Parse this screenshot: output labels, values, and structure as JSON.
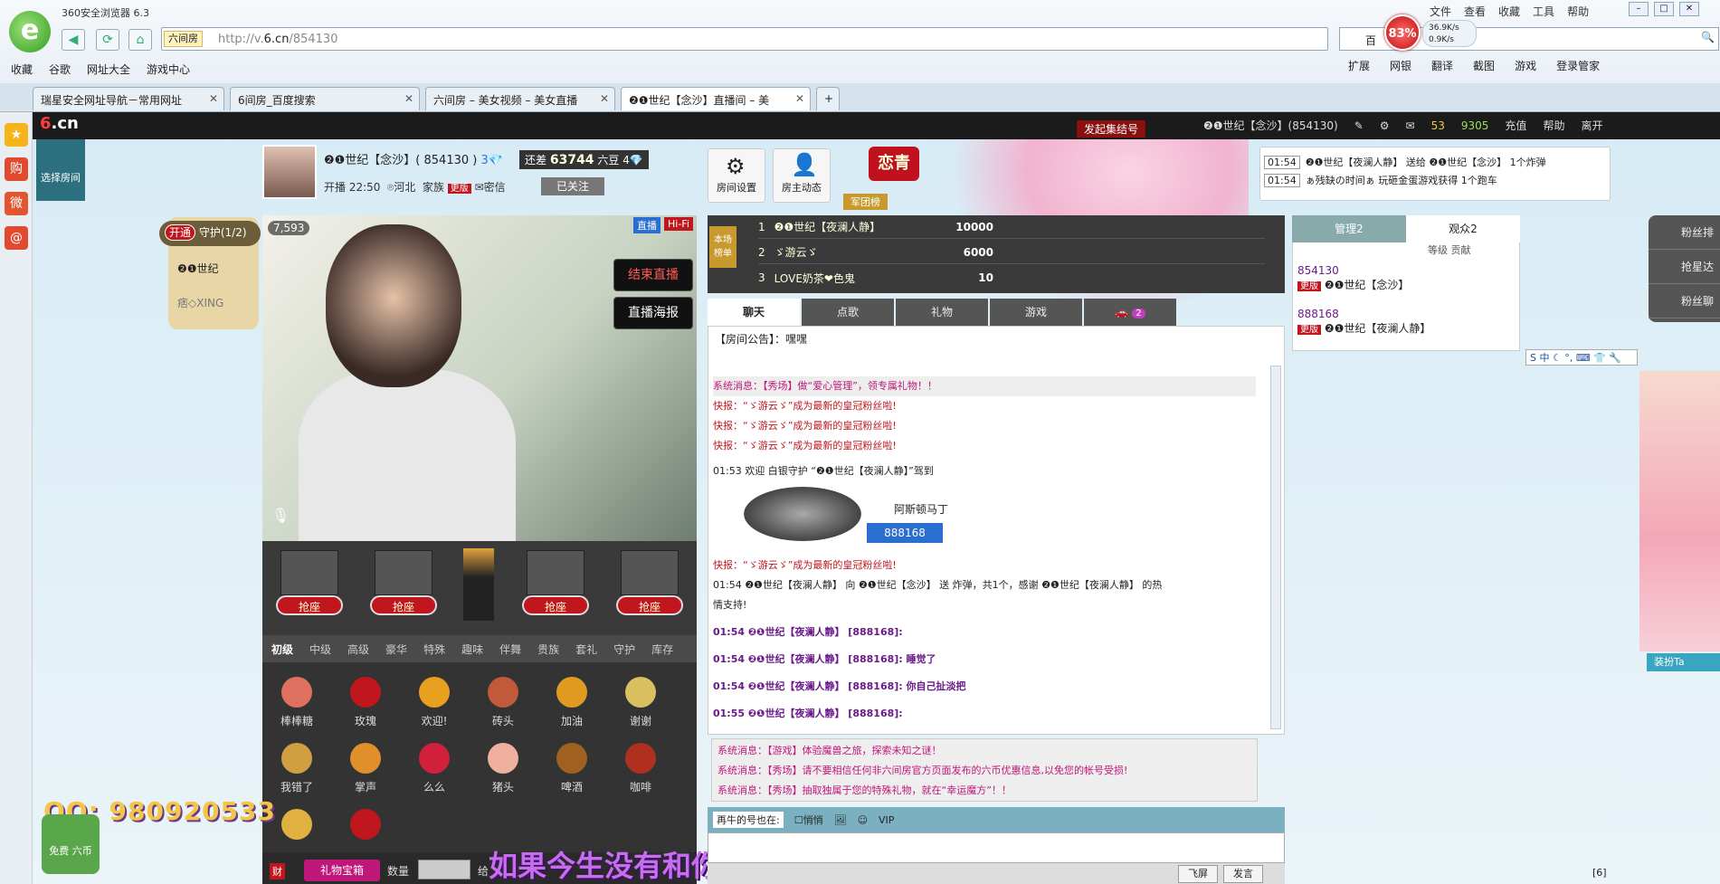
{
  "browser": {
    "title": "360安全浏览器 6.3",
    "menus": [
      "文件",
      "查看",
      "收藏",
      "工具",
      "帮助"
    ],
    "address_tag": "六间房",
    "url_prefix": "http://v.",
    "url_domain": "6.cn",
    "url_path": "/854130",
    "search_text": "百",
    "cpu": "83%",
    "speed_up": "36.9K/s",
    "speed_down": "0.9K/s",
    "favorites": [
      "收藏",
      "谷歌",
      "网址大全",
      "游戏中心"
    ],
    "right_tools": [
      "扩展",
      "网银",
      "翻译",
      "截图",
      "游戏",
      "登录管家"
    ],
    "tabs": [
      "瑞星安全网址导航－常用网址",
      "6间房_百度搜索",
      "六间房 – 美女视频 – 美女直播",
      "❷❶世纪【念沙】直播间 – 美"
    ]
  },
  "site": {
    "logo": "6.cn",
    "choose_room": "选择房间",
    "gathering": "发起集结号",
    "header_user": "❷❶世纪【念沙】(854130)",
    "header_coins": "53",
    "header_beans": "9305",
    "header_links": [
      "充值",
      "帮助",
      "离开"
    ],
    "anchor": {
      "name": "❷❶世纪【念沙】( 854130 )",
      "level": "3",
      "still_need_label": "还差",
      "still_need_value": "63744",
      "bean_label": "六豆",
      "next_level": "4",
      "start_time": "开播 22:50",
      "location": "河北",
      "family_label": "家族",
      "family_tag": "更版",
      "private_msg": "密信",
      "followed": "已关注"
    },
    "buttons": {
      "room_settings": "房间设置",
      "host_dynamics": "房主动态"
    },
    "lianqing": "恋青",
    "juntuan": "军团榜",
    "gift_notice": [
      {
        "time": "01:54",
        "text": "❷❶世纪【夜澜人静】 送给 ❷❶世纪【念沙】 1个炸弹"
      },
      {
        "time": "01:54",
        "text": "ぁ残缺の时间ぁ 玩砸金蛋游戏获得 1个跑车"
      }
    ],
    "guard": {
      "open": "开通",
      "title": "守护(1/2)",
      "members": [
        "❷❶世纪",
        "痞◇XING"
      ]
    },
    "video": {
      "count": "7,593",
      "tag1": "直播",
      "tag2": "Hi-Fi",
      "stop": "结束直播",
      "poster": "直播海报"
    },
    "seat_label": "抢座",
    "gift_tabs": [
      "初级",
      "中级",
      "高级",
      "豪华",
      "特殊",
      "趣味",
      "伴舞",
      "贵族",
      "套礼",
      "守护",
      "库存"
    ],
    "gifts": [
      "棒棒糖",
      "玫瑰",
      "欢迎!",
      "砖头",
      "加油",
      "谢谢",
      "我错了",
      "掌声",
      "么么",
      "猪头",
      "啤酒",
      "咖啡",
      "",
      "",
      ""
    ],
    "gift_box": "礼物宝箱",
    "quantity_label": "数量",
    "give_label": "给",
    "qq": "QQ: 980920533",
    "free_coin": "免费\n六币",
    "lyric": "如果今生没有和你相识",
    "rank": {
      "tag": "本场\n榜单",
      "rows": [
        {
          "rank": "1",
          "name": "❷❶世纪【夜澜人静】",
          "value": "10000"
        },
        {
          "rank": "2",
          "name": "ゞ游云ゞ",
          "value": "6000"
        },
        {
          "rank": "3",
          "name": "LOVE奶茶❤色鬼",
          "value": "10"
        }
      ]
    },
    "chat_tabs": [
      "聊天",
      "点歌",
      "礼物",
      "游戏",
      ""
    ],
    "chat_tab_badge": "2",
    "announcement": "【房间公告】：嘿嘿",
    "messages": [
      {
        "cls": "sys",
        "text": "系统消息：【秀场】做“爱心管理”，领专属礼物！！"
      },
      {
        "cls": "red",
        "text": "快报：“ゞ游云ゞ”成为最新的皇冠粉丝啦!"
      },
      {
        "cls": "red",
        "text": "快报：“ゞ游云ゞ”成为最新的皇冠粉丝啦!"
      },
      {
        "cls": "red",
        "text": "快报：“ゞ游云ゞ”成为最新的皇冠粉丝啦!"
      },
      {
        "cls": "",
        "text": "01:53 欢迎 白银守护 “❷❶世纪【夜澜人静】”驾到"
      }
    ],
    "car_name": "阿斯顿马丁",
    "car_number": "888168",
    "messages2": [
      {
        "cls": "red",
        "text": "快报：“ゞ游云ゞ”成为最新的皇冠粉丝啦!"
      },
      {
        "cls": "",
        "text": "01:54 ❷❶世纪【夜澜人静】 向 ❷❶世纪【念沙】 送 炸弹，共1个，感谢 ❷❶世纪【夜澜人静】 的热"
      },
      {
        "cls": "",
        "text": "情支持!"
      },
      {
        "cls": "",
        "text": "01:54 ❷❶世纪【夜澜人静】 [888168]:"
      },
      {
        "cls": "",
        "text": "01:54 ❷❶世纪【夜澜人静】 [888168]: 睡觉了"
      },
      {
        "cls": "",
        "text": "01:54 ❷❶世纪【夜澜人静】 [888168]: 你自己扯淡把"
      },
      {
        "cls": "",
        "text": "01:55 ❷❶世纪【夜澜人静】 [888168]:"
      }
    ],
    "system_msgs": [
      "系统消息：【游戏】体验魔兽之旅，探索未知之谜！",
      "系统消息：【秀场】请不要相信任何非六间房官方页面发布的六币优惠信息,以免您的帐号受损!",
      "系统消息：【秀场】抽取独属于您的特殊礼物，就在“幸运魔方”！！"
    ],
    "input_row": {
      "label": "再牛的号也在:",
      "whisper": "悄悄"
    },
    "send_buttons": [
      "飞屏",
      "发言"
    ],
    "users": {
      "tabs": [
        "管理2",
        "观众2"
      ],
      "sub": "等级 贡献",
      "rows": [
        {
          "id": "854130",
          "name": "❷❶世纪【念沙】"
        },
        {
          "id": "888168",
          "name": "❷❶世纪【夜澜人静】"
        }
      ],
      "tag": "更版"
    },
    "right_side": [
      "粉丝排",
      "抢星达",
      "粉丝聊"
    ],
    "dressup": "装扮Ta",
    "status_count": "[6]"
  }
}
